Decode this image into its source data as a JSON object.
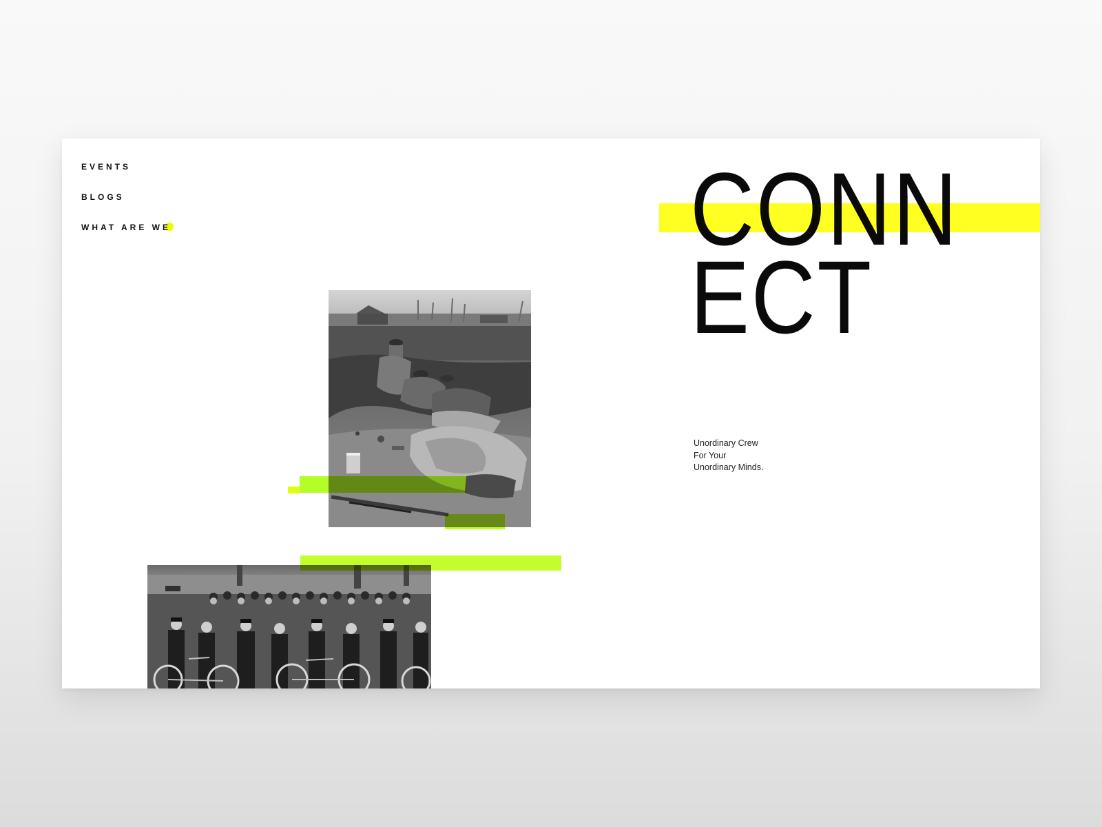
{
  "nav": {
    "items": [
      {
        "label": "EVENTS"
      },
      {
        "label": "BLOGS"
      },
      {
        "label": "WHAT ARE WE"
      }
    ]
  },
  "hero": {
    "title_line1": "CONN",
    "title_line2": "ECT"
  },
  "tagline": {
    "line1": "Unordinary Crew",
    "line2": "For Your",
    "line3": "Unordinary Minds."
  },
  "colors": {
    "accent": "#ffff22",
    "text": "#0a0a0a",
    "background": "#ffffff"
  }
}
